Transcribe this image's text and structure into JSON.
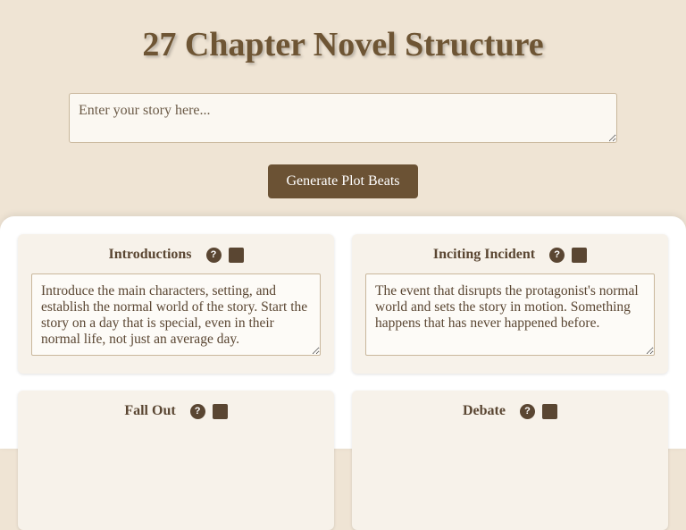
{
  "header": {
    "title_left_glyph": "",
    "title_text": "27 Chapter Novel Structure",
    "title_right_glyph": ""
  },
  "story": {
    "placeholder": "Enter your story here...",
    "value": ""
  },
  "generate_button": {
    "label": "Generate Plot Beats"
  },
  "card_buttons": {
    "help_label": "?",
    "action_glyph": ""
  },
  "beats": [
    {
      "title": "Introductions",
      "text": "Introduce the main characters, setting, and establish the normal world of the story. Start the story on a day that is special, even in their normal life, not just an average day."
    },
    {
      "title": "Inciting Incident",
      "text": "The event that disrupts the protagonist's normal world and sets the story in motion. Something happens that has never happened before."
    },
    {
      "title": "Fall Out",
      "text": ""
    },
    {
      "title": "Debate",
      "text": ""
    }
  ]
}
